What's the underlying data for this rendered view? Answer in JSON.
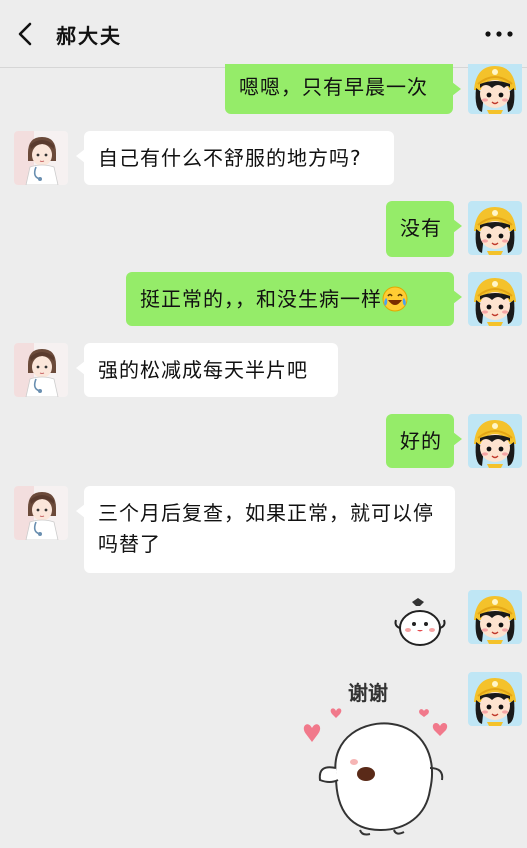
{
  "header": {
    "title": "郝大夫",
    "back_icon": "chevron-left-icon",
    "more_icon": "more-horizontal-icon"
  },
  "messages": [
    {
      "side": "right",
      "type": "text",
      "text": "嗯嗯，只有早晨一次"
    },
    {
      "side": "left",
      "type": "text",
      "text": "自己有什么不舒服的地方吗?"
    },
    {
      "side": "right",
      "type": "text",
      "text": "没有"
    },
    {
      "side": "right",
      "type": "text",
      "text": "挺正常的，，和没生病一样",
      "emoji": "laughing-tears-emoji"
    },
    {
      "side": "left",
      "type": "text",
      "text": "强的松减成每天半片吧"
    },
    {
      "side": "right",
      "type": "text",
      "text": "好的"
    },
    {
      "side": "left",
      "type": "text",
      "text": "三个月后复查，如果正常，就可以停吗替了"
    },
    {
      "side": "right",
      "type": "sticker",
      "sticker": "cute-blob-sticker"
    },
    {
      "side": "right",
      "type": "sticker",
      "sticker": "thank-you-blob-sticker",
      "text": "谢谢"
    }
  ],
  "colors": {
    "background": "#ededed",
    "sent_bubble": "#95ec69",
    "received_bubble": "#ffffff"
  }
}
